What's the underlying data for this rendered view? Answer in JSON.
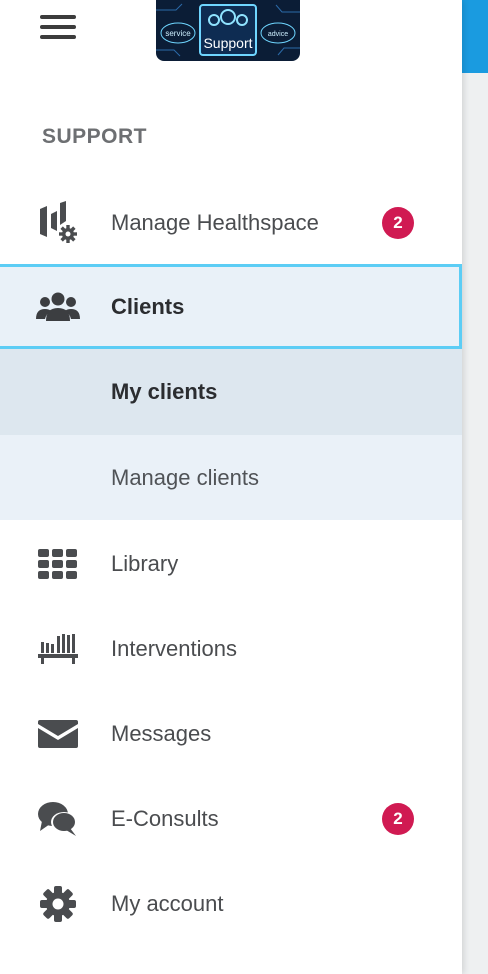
{
  "header": {
    "menu_icon": "hamburger-menu-icon",
    "logo": {
      "left_word": "service",
      "center_word": "Support",
      "right_word": "advice"
    }
  },
  "sidebar": {
    "section_title": "SUPPORT",
    "items": [
      {
        "label": "Manage Healthspace",
        "icon": "healthspace-settings-icon",
        "badge": "2"
      },
      {
        "label": "Clients",
        "icon": "users-group-icon",
        "active": true
      },
      {
        "label": "My clients",
        "sub": true,
        "selected": true
      },
      {
        "label": "Manage clients",
        "sub": true
      },
      {
        "label": "Library",
        "icon": "grid-icon"
      },
      {
        "label": "Interventions",
        "icon": "bookshelf-icon"
      },
      {
        "label": "Messages",
        "icon": "envelope-icon"
      },
      {
        "label": "E-Consults",
        "icon": "chat-bubbles-icon",
        "badge": "2"
      },
      {
        "label": "My account",
        "icon": "gear-icon"
      }
    ]
  },
  "colors": {
    "badge": "#d01a52",
    "active_border": "#5ccdf5",
    "active_bg": "#e9f1f8",
    "accent_blue": "#1a9be0",
    "icon_gray": "#4a4c4f"
  }
}
